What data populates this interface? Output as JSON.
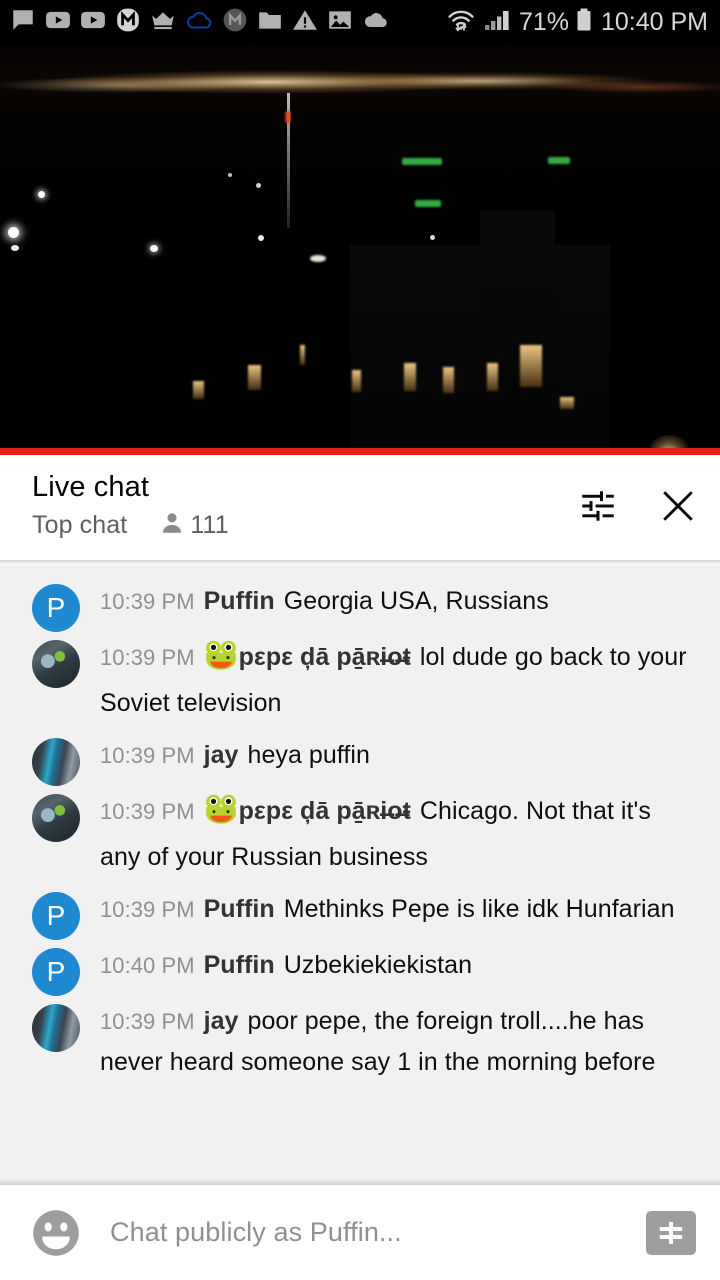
{
  "statusbar": {
    "icons": [
      {
        "name": "chat-bubble-icon"
      },
      {
        "name": "youtube-play-icon"
      },
      {
        "name": "youtube-play-icon-2"
      },
      {
        "name": "messenger-m-icon"
      },
      {
        "name": "crown-icon"
      },
      {
        "name": "cloud-outline-icon"
      },
      {
        "name": "circle-m-icon"
      },
      {
        "name": "folder-icon"
      },
      {
        "name": "warning-triangle-icon"
      },
      {
        "name": "image-icon"
      },
      {
        "name": "cloud-filled-icon"
      }
    ],
    "wifi_icon": "wifi-icon",
    "signal_icon": "cell-signal-icon",
    "battery_percent": "71%",
    "battery_icon": "battery-icon",
    "time": "10:40 PM"
  },
  "video": {
    "name": "live-video-player",
    "description": "night cityscape livestream",
    "progress_percent": 100
  },
  "chat_header": {
    "title": "Live chat",
    "mode": "Top chat",
    "viewer_icon": "person-icon",
    "viewer_count": "111",
    "settings_icon": "tune-sliders-icon",
    "close_icon": "close-icon"
  },
  "messages": [
    {
      "avatar_type": "letter",
      "avatar_letter": "P",
      "avatar_color": "#1e88d0",
      "timestamp": "10:39 PM",
      "author": "Puffin",
      "badge": "",
      "text": "Georgia USA, Russians"
    },
    {
      "avatar_type": "photo-pepe",
      "avatar_letter": "",
      "avatar_color": "",
      "timestamp": "10:39 PM",
      "author": "pεpε ḑā pā̱ʀi̶o̶ŧ",
      "badge": "frog-emoji",
      "text": "lol dude go back to your Soviet television"
    },
    {
      "avatar_type": "photo-jay",
      "avatar_letter": "",
      "avatar_color": "",
      "timestamp": "10:39 PM",
      "author": "jay",
      "badge": "",
      "text": "heya puffin"
    },
    {
      "avatar_type": "photo-pepe",
      "avatar_letter": "",
      "avatar_color": "",
      "timestamp": "10:39 PM",
      "author": "pεpε ḑā pā̱ʀi̶o̶ŧ",
      "badge": "frog-emoji",
      "text": "Chicago. Not that it's any of your Russian business"
    },
    {
      "avatar_type": "letter",
      "avatar_letter": "P",
      "avatar_color": "#1e88d0",
      "timestamp": "10:39 PM",
      "author": "Puffin",
      "badge": "",
      "text": "Methinks Pepe is like idk Hunfarian"
    },
    {
      "avatar_type": "letter",
      "avatar_letter": "P",
      "avatar_color": "#1e88d0",
      "timestamp": "10:40 PM",
      "author": "Puffin",
      "badge": "",
      "text": "Uzbekiekiekistan"
    },
    {
      "avatar_type": "photo-jay",
      "avatar_letter": "",
      "avatar_color": "",
      "timestamp": "10:39 PM",
      "author": "jay",
      "badge": "",
      "text": "poor pepe, the foreign troll....he has never heard someone say 1 in the morning before"
    }
  ],
  "input_bar": {
    "emoji_icon": "emoji-smiley-icon",
    "placeholder": "Chat publicly as Puffin...",
    "superchat_icon": "dollar-superchat-icon"
  },
  "colors": {
    "accent_red": "#e62117",
    "avatar_blue": "#1e88d0",
    "chat_bg": "#f1f1f1",
    "status_bg": "#000000",
    "muted_text": "#909090"
  }
}
